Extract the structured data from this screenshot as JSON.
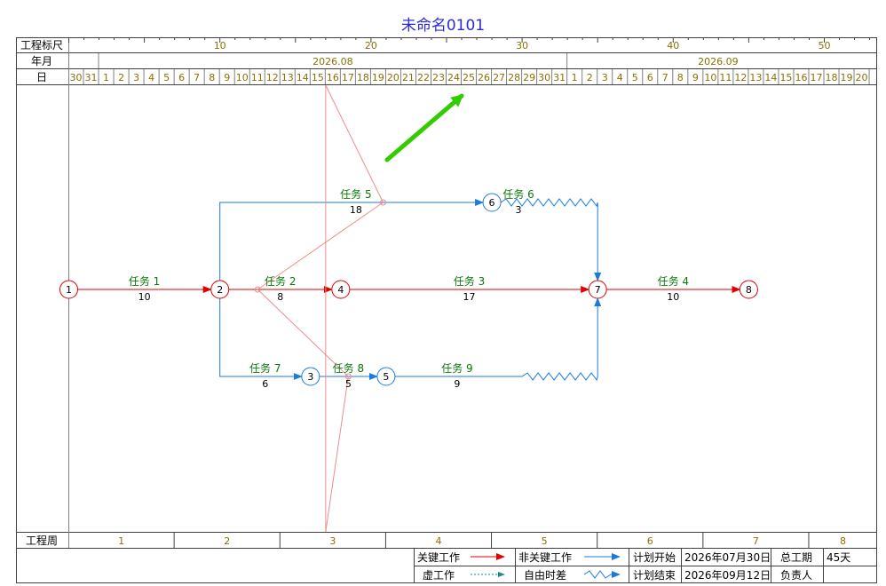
{
  "title": "未命名0101",
  "header": {
    "ruler_label": "工程标尺",
    "month_label": "年月",
    "day_label": "日",
    "ruler_numbers": [
      "10",
      "20",
      "30",
      "40",
      "50"
    ],
    "months": [
      "2026.08",
      "2026.09"
    ],
    "days": [
      "30",
      "31",
      "1",
      "2",
      "3",
      "4",
      "5",
      "6",
      "7",
      "8",
      "9",
      "10",
      "11",
      "12",
      "13",
      "14",
      "15",
      "16",
      "17",
      "18",
      "19",
      "20",
      "21",
      "22",
      "23",
      "24",
      "25",
      "26",
      "27",
      "28",
      "29",
      "30",
      "31",
      "1",
      "2",
      "3",
      "4",
      "5",
      "6",
      "7",
      "8",
      "9",
      "10",
      "11",
      "12",
      "13",
      "14",
      "15",
      "16",
      "17",
      "18",
      "19",
      "20"
    ]
  },
  "footer": {
    "week_label": "工程周",
    "weeks": [
      "1",
      "2",
      "3",
      "4",
      "5",
      "6",
      "7",
      "8"
    ]
  },
  "legend": {
    "critical": "关键工作",
    "noncritical": "非关键工作",
    "dummy": "虚工作",
    "free_float": "自由时差",
    "plan_start_label": "计划开始",
    "plan_start": "2026年07月30日",
    "plan_end_label": "计划结束",
    "plan_end": "2026年09月12日",
    "duration_label": "总工期",
    "duration": "45天",
    "owner_label": "负责人",
    "owner": ""
  },
  "colors": {
    "critical": "#e00000",
    "noncritical": "#1a7ae0",
    "dummy": "#1a8a8a",
    "task_label": "#0a7a0a",
    "header_text": "#8a7000",
    "title": "#2b2bd4",
    "progress_line": "#f08c8c",
    "arrow_annotation": "#33cc00"
  },
  "network": {
    "nodes": [
      {
        "id": "1",
        "day": 0,
        "row": 0,
        "type": "critical"
      },
      {
        "id": "2",
        "day": 10,
        "row": 0,
        "type": "critical"
      },
      {
        "id": "4",
        "day": 18,
        "row": 0,
        "type": "critical"
      },
      {
        "id": "7",
        "day": 35,
        "row": 0,
        "type": "critical"
      },
      {
        "id": "8",
        "day": 45,
        "row": 0,
        "type": "critical"
      },
      {
        "id": "6",
        "day": 28,
        "row": -1,
        "type": "noncritical"
      },
      {
        "id": "3",
        "day": 16,
        "row": 1,
        "type": "noncritical"
      },
      {
        "id": "5",
        "day": 21,
        "row": 1,
        "type": "noncritical"
      }
    ],
    "tasks": [
      {
        "name": "任务 1",
        "duration": "10",
        "from": "1",
        "to": "2",
        "critical": true
      },
      {
        "name": "任务 2",
        "duration": "8",
        "from": "2",
        "to": "4",
        "critical": true
      },
      {
        "name": "任务 3",
        "duration": "17",
        "from": "4",
        "to": "7",
        "critical": true
      },
      {
        "name": "任务 4",
        "duration": "10",
        "from": "7",
        "to": "8",
        "critical": true
      },
      {
        "name": "任务 5",
        "duration": "18",
        "from": "2",
        "to": "6",
        "critical": false
      },
      {
        "name": "任务 6",
        "duration": "3",
        "from": "6",
        "to": "7",
        "critical": false,
        "float_end_day": 35
      },
      {
        "name": "任务 7",
        "duration": "6",
        "from": "2",
        "to": "3",
        "critical": false
      },
      {
        "name": "任务 8",
        "duration": "5",
        "from": "3",
        "to": "5",
        "critical": false
      },
      {
        "name": "任务 9",
        "duration": "9",
        "from": "5",
        "to": "7",
        "critical": false,
        "float_start_day": 30,
        "float_end_day": 35
      }
    ],
    "progress_line": [
      {
        "day": 17,
        "row": "top"
      },
      {
        "day": 20.8,
        "row": -1
      },
      {
        "day": 12.5,
        "row": 0
      },
      {
        "day": 18.5,
        "row": 1
      },
      {
        "day": 17,
        "row": "bottom"
      }
    ]
  }
}
